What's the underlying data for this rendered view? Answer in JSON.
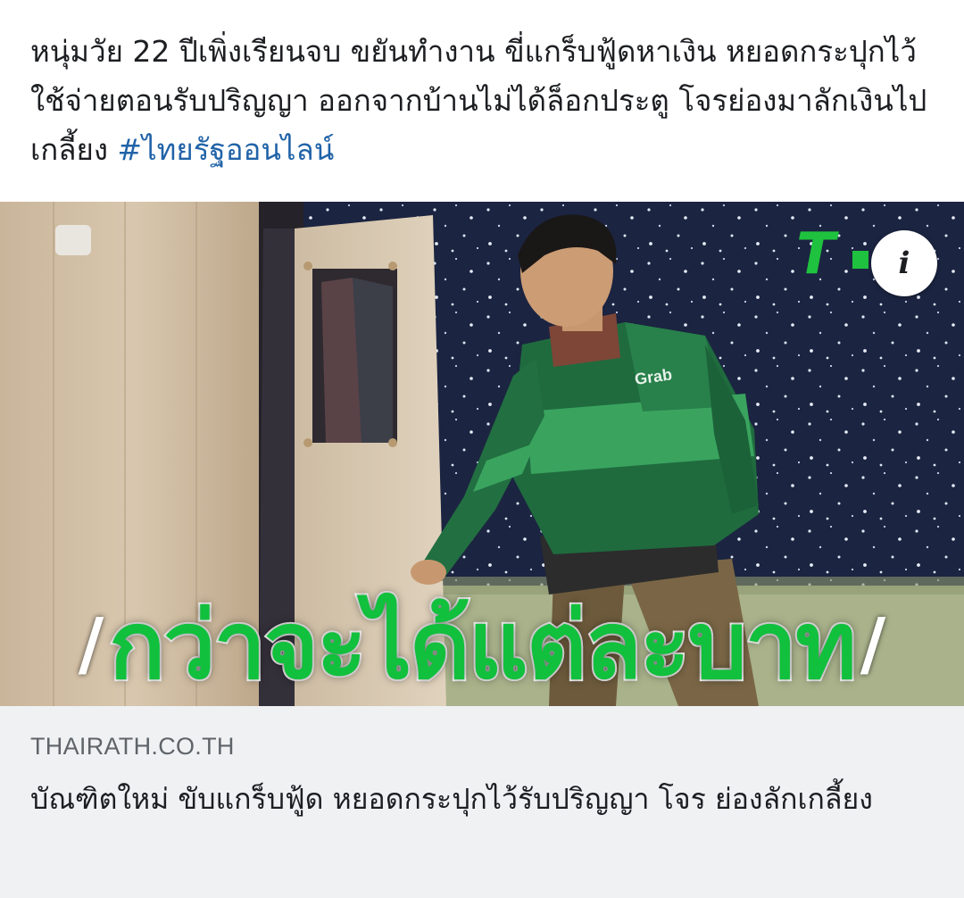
{
  "post": {
    "text": "หนุ่มวัย 22 ปีเพิ่งเรียนจบ ขยันทำงาน ขี่แกร็บฟู้ดหาเงิน หยอดกระปุกไว้ใช้จ่ายตอนรับปริญญา ออกจากบ้านไม่ได้ล็อกประตู โจรย่องมาลักเงินไปเกลี้ยง ",
    "hashtag": "#ไทยรัฐออนไลน์"
  },
  "image": {
    "overlay_text": "กว่าจะได้แต่ละบาท",
    "slash_left": "/",
    "slash_right": "/",
    "jacket_logo": "Grab",
    "corner_logo": "T",
    "corner_logo_color": "#1fc23e",
    "info_icon": "i"
  },
  "link_card": {
    "domain": "THAIRATH.CO.TH",
    "title": "บัณฑิตใหม่ ขับแกร็บฟู้ด หยอดกระปุกไว้รับปริญญา โจร ย่องลักเกลี้ยง"
  },
  "colors": {
    "hashtag": "#2163a8",
    "overlay_green": "#11c03c",
    "card_bg": "#eff1f3"
  }
}
